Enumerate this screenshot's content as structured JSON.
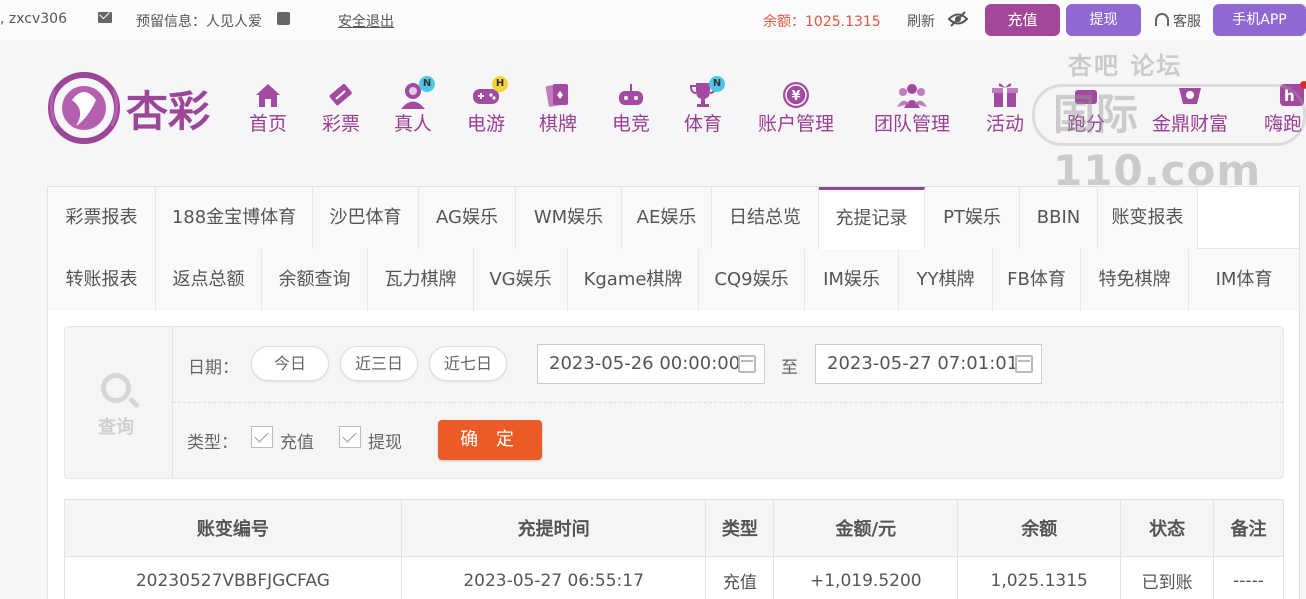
{
  "top": {
    "user": ", zxcv306",
    "reserve": "预留信息：人见人爱",
    "logout": "安全退出",
    "balance": "余额：1025.1315",
    "refresh": "刷新",
    "recharge": "充值",
    "withdraw": "提现",
    "service": "客服",
    "app": "手机APP"
  },
  "logo_text": "杏彩",
  "nav": [
    {
      "label": "首页",
      "icon": "home-icon"
    },
    {
      "label": "彩票",
      "icon": "ticket-icon"
    },
    {
      "label": "真人",
      "icon": "dealer-icon",
      "badge": "N"
    },
    {
      "label": "电游",
      "icon": "gamepad-icon",
      "badge": "H"
    },
    {
      "label": "棋牌",
      "icon": "cards-icon"
    },
    {
      "label": "电竞",
      "icon": "joystick-icon"
    },
    {
      "label": "体育",
      "icon": "trophy-icon",
      "badge": "N"
    },
    {
      "label": "账户管理",
      "icon": "yen-icon"
    },
    {
      "label": "团队管理",
      "icon": "team-icon"
    },
    {
      "label": "活动",
      "icon": "gift-icon"
    },
    {
      "label": "跑分",
      "icon": "run-icon"
    },
    {
      "label": "金鼎财富",
      "icon": "wealth-icon"
    },
    {
      "label": "嗨跑",
      "icon": "hi-icon"
    }
  ],
  "watermark": {
    "line1": "杏吧    论坛",
    "line2": "国际110.com"
  },
  "tabs_row1": [
    "彩票报表",
    "188金宝博体育",
    "沙巴体育",
    "AG娱乐",
    "WM娱乐",
    "AE娱乐",
    "日结总览",
    "充提记录",
    "PT娱乐",
    "BBIN",
    "账变报表"
  ],
  "tabs_row2": [
    "转账报表",
    "返点总额",
    "余额查询",
    "瓦力棋牌",
    "VG娱乐",
    "Kgame棋牌",
    "CQ9娱乐",
    "IM娱乐",
    "YY棋牌",
    "FB体育",
    "特免棋牌",
    "IM体育"
  ],
  "active_tab": "充提记录",
  "search": {
    "query_label": "查询",
    "date_label": "日期：",
    "quick": [
      "今日",
      "近三日",
      "近七日"
    ],
    "start": "2023-05-26 00:00:00",
    "to": "至",
    "end": "2023-05-27 07:01:01",
    "type_label": "类型：",
    "types": [
      "充值",
      "提现"
    ],
    "confirm": "确 定"
  },
  "table": {
    "headers": [
      "账变编号",
      "充提时间",
      "类型",
      "金额/元",
      "余额",
      "状态",
      "备注"
    ],
    "rows": [
      [
        "20230527VBBFJGCFAG",
        "2023-05-27 06:55:17",
        "充值",
        "+1,019.5200",
        "1,025.1315",
        "已到账",
        "-----"
      ]
    ]
  }
}
